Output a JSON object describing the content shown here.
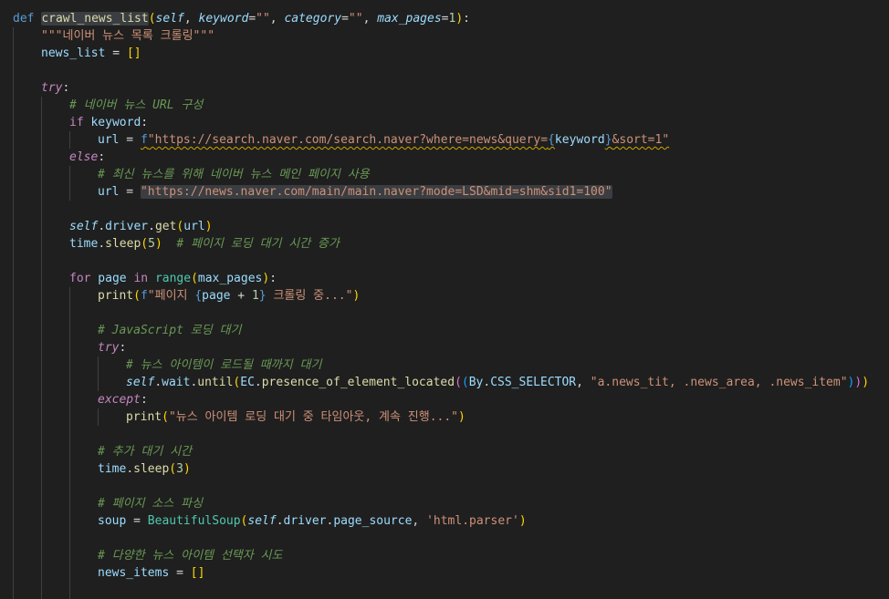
{
  "theme": {
    "background": "#1f1f1f",
    "colors": {
      "kw": "#569cd6",
      "ctl": "#c586c0",
      "fn": "#dcdcaa",
      "var": "#9cdcfe",
      "param": "#9cdcfe",
      "str": "#ce9178",
      "num": "#b5cea8",
      "cmt": "#6a9955",
      "cls": "#4ec9b0",
      "plain": "#d4d4d4",
      "b1": "#ffd700",
      "b2": "#da70d6",
      "b3": "#179fff",
      "fbr": "#569cd6"
    }
  },
  "code": {
    "lines": [
      {
        "indent": 0,
        "tokens": [
          [
            "def ",
            "kw"
          ],
          [
            "crawl_news_list",
            "fn"
          ],
          [
            "(",
            "b1"
          ],
          [
            "self",
            "param"
          ],
          [
            ", ",
            "plain"
          ],
          [
            "keyword",
            "param"
          ],
          [
            "=",
            "plain"
          ],
          [
            "\"\"",
            "str"
          ],
          [
            ", ",
            "plain"
          ],
          [
            "category",
            "param"
          ],
          [
            "=",
            "plain"
          ],
          [
            "\"\"",
            "str"
          ],
          [
            ", ",
            "plain"
          ],
          [
            "max_pages",
            "param"
          ],
          [
            "=",
            "plain"
          ],
          [
            "1",
            "num"
          ],
          [
            ")",
            "b1"
          ],
          [
            ":",
            "plain"
          ]
        ]
      },
      {
        "indent": 1,
        "tokens": [
          [
            "\"\"\"네이버 뉴스 목록 크롤링\"\"\"",
            "str"
          ]
        ]
      },
      {
        "indent": 1,
        "tokens": [
          [
            "news_list",
            "var"
          ],
          [
            " = ",
            "plain"
          ],
          [
            "[]",
            "b1"
          ]
        ]
      },
      {
        "indent": 0,
        "tokens": []
      },
      {
        "indent": 1,
        "tokens": [
          [
            "try",
            "ctl"
          ],
          [
            ":",
            "plain"
          ]
        ]
      },
      {
        "indent": 2,
        "tokens": [
          [
            "# 네이버 뉴스 URL 구성",
            "cmt"
          ]
        ]
      },
      {
        "indent": 2,
        "tokens": [
          [
            "if",
            "ctl"
          ],
          [
            " keyword",
            "var"
          ],
          [
            ":",
            "plain"
          ]
        ]
      },
      {
        "indent": 3,
        "tokens": [
          [
            "url",
            "var"
          ],
          [
            " = ",
            "plain"
          ],
          [
            "f",
            "fbr"
          ],
          [
            "\"https://search.naver.com/search.naver?where=news&query=",
            "str"
          ],
          [
            "{",
            "fbr"
          ],
          [
            "keyword",
            "var"
          ],
          [
            "}",
            "fbr"
          ],
          [
            "&sort=1\"",
            "str"
          ]
        ]
      },
      {
        "indent": 2,
        "tokens": [
          [
            "else",
            "ctl"
          ],
          [
            ":",
            "plain"
          ]
        ]
      },
      {
        "indent": 3,
        "tokens": [
          [
            "# 최신 뉴스를 위해 네이버 뉴스 메인 페이지 사용",
            "cmt"
          ]
        ]
      },
      {
        "indent": 3,
        "tokens": [
          [
            "url",
            "var"
          ],
          [
            " = ",
            "plain"
          ],
          [
            "\"https://news.naver.com/main/main.naver?mode=LSD&mid=shm&sid1=100\"",
            "str"
          ]
        ]
      },
      {
        "indent": 0,
        "tokens": []
      },
      {
        "indent": 2,
        "tokens": [
          [
            "self",
            "param"
          ],
          [
            ".",
            "plain"
          ],
          [
            "driver",
            "var"
          ],
          [
            ".",
            "plain"
          ],
          [
            "get",
            "fn"
          ],
          [
            "(",
            "b1"
          ],
          [
            "url",
            "var"
          ],
          [
            ")",
            "b1"
          ]
        ]
      },
      {
        "indent": 2,
        "tokens": [
          [
            "time",
            "var"
          ],
          [
            ".",
            "plain"
          ],
          [
            "sleep",
            "fn"
          ],
          [
            "(",
            "b1"
          ],
          [
            "5",
            "num"
          ],
          [
            ")",
            "b1"
          ],
          [
            "  ",
            "plain"
          ],
          [
            "# 페이지 로딩 대기 시간 증가",
            "cmt"
          ]
        ]
      },
      {
        "indent": 0,
        "tokens": []
      },
      {
        "indent": 2,
        "tokens": [
          [
            "for",
            "ctl"
          ],
          [
            " page ",
            "var"
          ],
          [
            "in",
            "ctl"
          ],
          [
            " ",
            "plain"
          ],
          [
            "range",
            "cls"
          ],
          [
            "(",
            "b1"
          ],
          [
            "max_pages",
            "var"
          ],
          [
            ")",
            "b1"
          ],
          [
            ":",
            "plain"
          ]
        ]
      },
      {
        "indent": 3,
        "tokens": [
          [
            "print",
            "fn"
          ],
          [
            "(",
            "b1"
          ],
          [
            "f",
            "fbr"
          ],
          [
            "\"페이지 ",
            "str"
          ],
          [
            "{",
            "fbr"
          ],
          [
            "page",
            "var"
          ],
          [
            " + ",
            "plain"
          ],
          [
            "1",
            "num"
          ],
          [
            "}",
            "fbr"
          ],
          [
            " 크롤링 중...\"",
            "str"
          ],
          [
            ")",
            "b1"
          ]
        ]
      },
      {
        "indent": 0,
        "tokens": []
      },
      {
        "indent": 3,
        "tokens": [
          [
            "# JavaScript 로딩 대기",
            "cmt"
          ]
        ]
      },
      {
        "indent": 3,
        "tokens": [
          [
            "try",
            "ctl"
          ],
          [
            ":",
            "plain"
          ]
        ]
      },
      {
        "indent": 4,
        "tokens": [
          [
            "# 뉴스 아이템이 로드될 때까지 대기",
            "cmt"
          ]
        ]
      },
      {
        "indent": 4,
        "tokens": [
          [
            "self",
            "param"
          ],
          [
            ".",
            "plain"
          ],
          [
            "wait",
            "var"
          ],
          [
            ".",
            "plain"
          ],
          [
            "until",
            "fn"
          ],
          [
            "(",
            "b1"
          ],
          [
            "EC",
            "var"
          ],
          [
            ".",
            "plain"
          ],
          [
            "presence_of_element_located",
            "fn"
          ],
          [
            "(",
            "b2"
          ],
          [
            "(",
            "b3"
          ],
          [
            "By",
            "var"
          ],
          [
            ".",
            "plain"
          ],
          [
            "CSS_SELECTOR",
            "var"
          ],
          [
            ", ",
            "plain"
          ],
          [
            "\"a.news_tit, .news_area, .news_item\"",
            "str"
          ],
          [
            ")",
            "b3"
          ],
          [
            ")",
            "b2"
          ],
          [
            ")",
            "b1"
          ]
        ]
      },
      {
        "indent": 3,
        "tokens": [
          [
            "except",
            "ctl"
          ],
          [
            ":",
            "plain"
          ]
        ]
      },
      {
        "indent": 4,
        "tokens": [
          [
            "print",
            "fn"
          ],
          [
            "(",
            "b1"
          ],
          [
            "\"뉴스 아이템 로딩 대기 중 타임아웃, 계속 진행...\"",
            "str"
          ],
          [
            ")",
            "b1"
          ]
        ]
      },
      {
        "indent": 0,
        "tokens": []
      },
      {
        "indent": 3,
        "tokens": [
          [
            "# 추가 대기 시간",
            "cmt"
          ]
        ]
      },
      {
        "indent": 3,
        "tokens": [
          [
            "time",
            "var"
          ],
          [
            ".",
            "plain"
          ],
          [
            "sleep",
            "fn"
          ],
          [
            "(",
            "b1"
          ],
          [
            "3",
            "num"
          ],
          [
            ")",
            "b1"
          ]
        ]
      },
      {
        "indent": 0,
        "tokens": []
      },
      {
        "indent": 3,
        "tokens": [
          [
            "# 페이지 소스 파싱",
            "cmt"
          ]
        ]
      },
      {
        "indent": 3,
        "tokens": [
          [
            "soup",
            "var"
          ],
          [
            " = ",
            "plain"
          ],
          [
            "BeautifulSoup",
            "cls"
          ],
          [
            "(",
            "b1"
          ],
          [
            "self",
            "param"
          ],
          [
            ".",
            "plain"
          ],
          [
            "driver",
            "var"
          ],
          [
            ".",
            "plain"
          ],
          [
            "page_source",
            "var"
          ],
          [
            ", ",
            "plain"
          ],
          [
            "'html.parser'",
            "str"
          ],
          [
            ")",
            "b1"
          ]
        ]
      },
      {
        "indent": 0,
        "tokens": []
      },
      {
        "indent": 3,
        "tokens": [
          [
            "# 다양한 뉴스 아이템 선택자 시도",
            "cmt"
          ]
        ]
      },
      {
        "indent": 3,
        "tokens": [
          [
            "news_items",
            "var"
          ],
          [
            " = ",
            "plain"
          ],
          [
            "[]",
            "b1"
          ]
        ]
      },
      {
        "indent": 0,
        "tokens": []
      }
    ]
  }
}
